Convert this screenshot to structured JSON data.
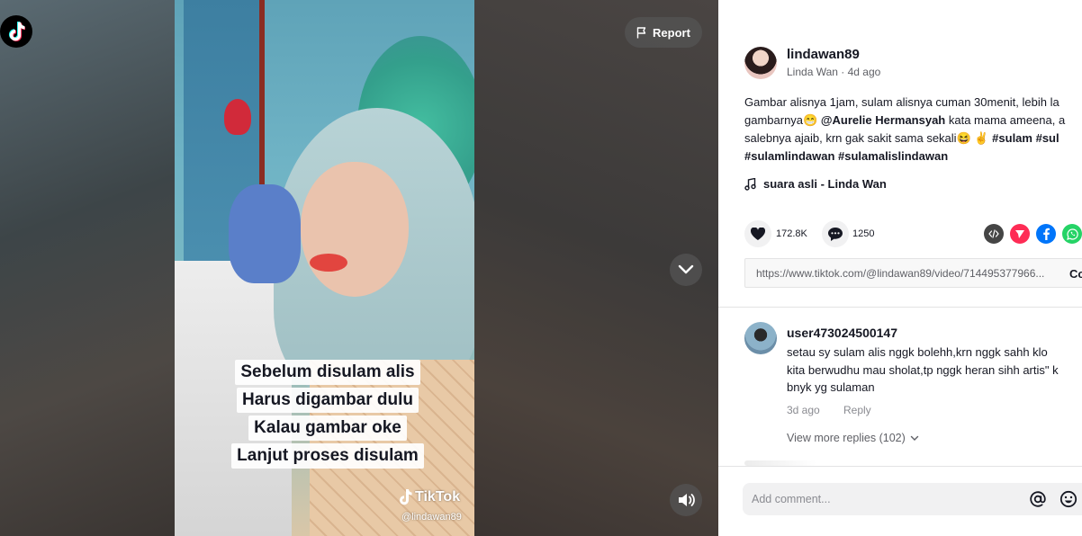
{
  "video": {
    "report_label": "Report",
    "caption_lines": [
      "Sebelum disulam alis",
      "Harus digambar dulu",
      "Kalau gambar oke",
      "Lanjut proses disulam"
    ],
    "watermark_brand": "TikTok",
    "watermark_handle": "@lindawan89",
    "icons": {
      "logo": "tiktok-logo-icon",
      "report": "flag-icon",
      "next": "chevron-down-icon",
      "volume": "volume-icon"
    }
  },
  "post": {
    "username": "lindawan89",
    "display_name": "Linda Wan",
    "separator": " · ",
    "time_ago": "4d ago",
    "description": {
      "line1": "Gambar alisnya 1jam, sulam alisnya cuman 30menit, lebih la",
      "line2_pre": "gambarnya😁 ",
      "mention": "@Aurelie Hermansyah",
      "line2_post": " kata mama ameena, a",
      "line3_pre": "salebnya ajaib, krn gak sakit sama sekali😆 ✌️ ",
      "tag1": "#sulam",
      "tag2": " #sul",
      "line4": "#sulamlindawan #sulamalislindawan"
    },
    "music": "suara asli - Linda Wan",
    "likes": "172.8K",
    "comments": "1250",
    "link_url": "https://www.tiktok.com/@lindawan89/video/714495377966...",
    "copy_label": "Co"
  },
  "comment": {
    "user": "user473024500147",
    "lines": [
      "setau sy sulam alis nggk bolehh,krn nggk sahh klo",
      "kita berwudhu mau sholat,tp nggk heran sihh artis\" k",
      "bnyk yg sulaman"
    ],
    "date": "3d ago",
    "reply_label": "Reply",
    "view_replies": "View more replies (102)"
  },
  "composer": {
    "placeholder": "Add comment..."
  },
  "colors": {
    "accent": "#fe2c55",
    "facebook": "#0075fa",
    "whatsapp": "#25d366",
    "text": "#161823"
  }
}
